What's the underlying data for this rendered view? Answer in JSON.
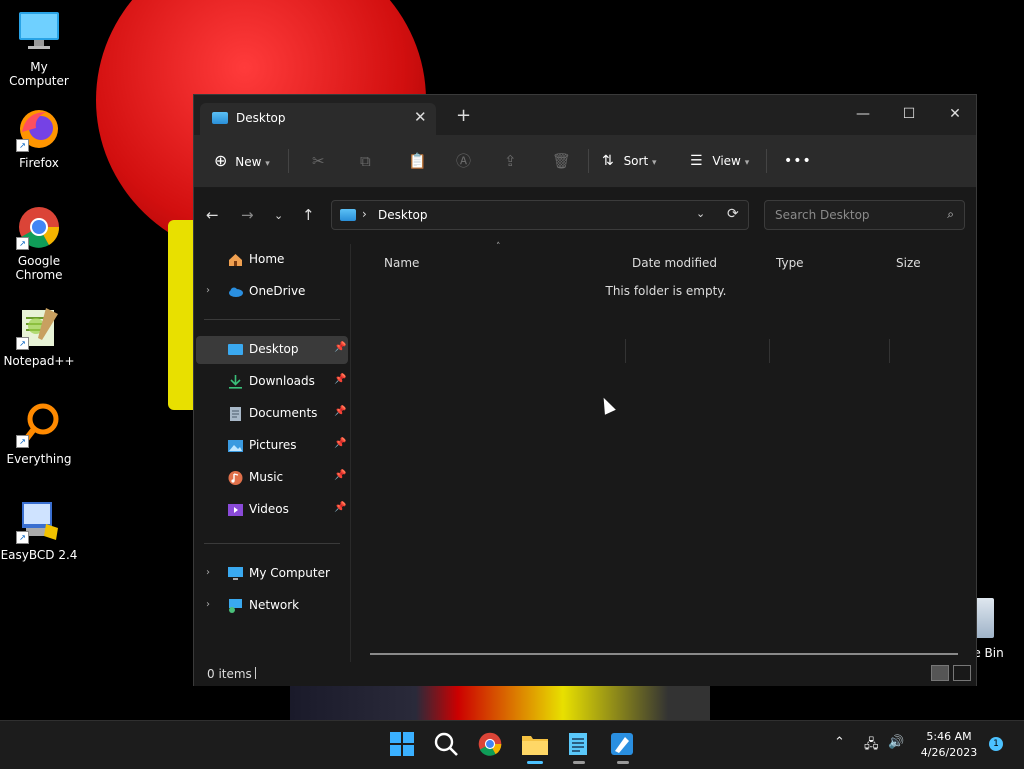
{
  "desktop": {
    "icons": [
      {
        "label": "My Computer"
      },
      {
        "label": "Firefox"
      },
      {
        "label": "Google Chrome"
      },
      {
        "label": "Notepad++"
      },
      {
        "label": "Everything"
      },
      {
        "label": "EasyBCD 2.4"
      }
    ],
    "recycle_partial_label": "le Bin"
  },
  "window": {
    "tab_title": "Desktop",
    "tab_close_glyph": "✕",
    "new_tab_glyph": "+",
    "controls": {
      "minimize": "—",
      "maximize": "☐",
      "close": "✕"
    },
    "toolbar": {
      "new_label": "New",
      "sort_label": "Sort",
      "view_label": "View",
      "more_glyph": "•••"
    },
    "address": {
      "path_label": "Desktop",
      "search_placeholder": "Search Desktop"
    },
    "nav_pane": {
      "quick": [
        {
          "label": "Home"
        },
        {
          "label": "OneDrive"
        }
      ],
      "pinned": [
        {
          "label": "Desktop"
        },
        {
          "label": "Downloads"
        },
        {
          "label": "Documents"
        },
        {
          "label": "Pictures"
        },
        {
          "label": "Music"
        },
        {
          "label": "Videos"
        }
      ],
      "devices": [
        {
          "label": "My Computer"
        },
        {
          "label": "Network"
        }
      ]
    },
    "columns": {
      "name": "Name",
      "date_modified": "Date modified",
      "type": "Type",
      "size": "Size"
    },
    "empty_message": "This folder is empty.",
    "status": {
      "item_count": "0 items"
    }
  },
  "taskbar": {
    "clock_time": "5:46 AM",
    "clock_date": "4/26/2023",
    "notification_count": "1"
  },
  "colors": {
    "accent": "#4cc2ff",
    "window_bg": "#191919",
    "toolbar_bg": "#2b2b2b",
    "selected_bg": "#3a3a3a"
  }
}
